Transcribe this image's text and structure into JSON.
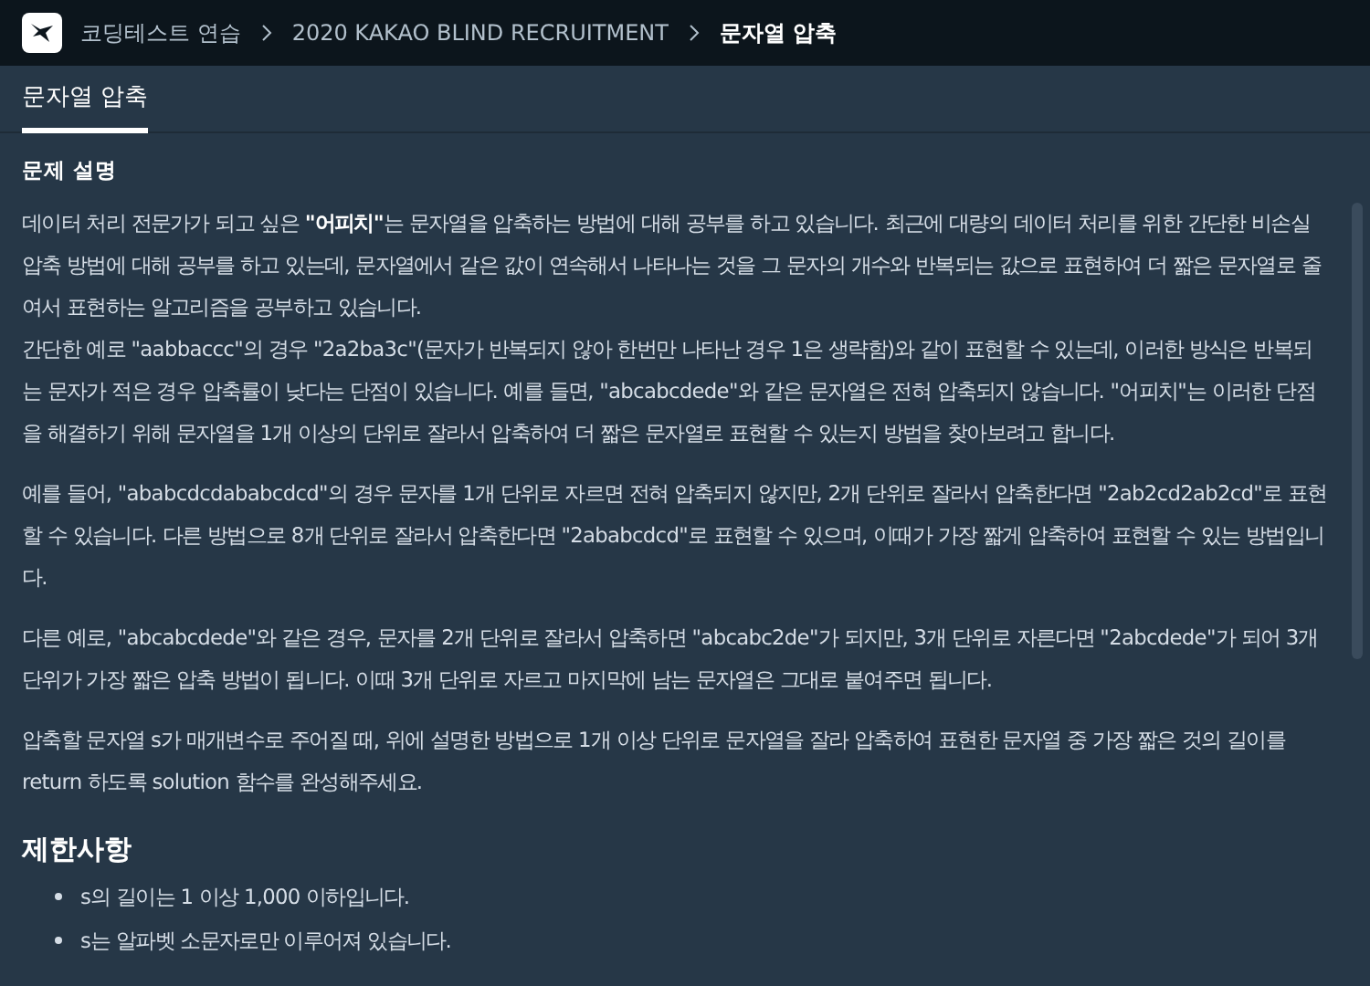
{
  "breadcrumb": [
    {
      "label": "코딩테스트 연습",
      "current": false
    },
    {
      "label": "2020 KAKAO BLIND RECRUITMENT",
      "current": false
    },
    {
      "label": "문자열 압축",
      "current": true
    }
  ],
  "tabs": [
    {
      "label": "문자열 압축",
      "selected": true
    }
  ],
  "section_title": "문제 설명",
  "paragraphs": [
    {
      "kind": "start",
      "text": "데이터 처리 전문가가 되고 싶은 **\"어피치\"**는 문자열을 압축하는 방법에 대해 공부를 하고 있습니다. 최근에 대량의 데이터 처리를 위한 간단한 비손실 압축 방법에 대해 공부를 하고 있는데, 문자열에서 같은 값이 연속해서 나타나는 것을 그 문자의 개수와 반복되는 값으로 표현하여 더 짧은 문자열로 줄여서 표현하는 알고리즘을 공부하고 있습니다."
    },
    {
      "kind": "continuation",
      "text": "간단한 예로 \"aabbaccc\"의 경우 \"2a2ba3c\"(문자가 반복되지 않아 한번만 나타난 경우 1은 생략함)와 같이 표현할 수 있는데, 이러한 방식은 반복되는 문자가 적은 경우 압축률이 낮다는 단점이 있습니다. 예를 들면, \"abcabcdede\"와 같은 문자열은 전혀 압축되지 않습니다. \"어피치\"는 이러한 단점을 해결하기 위해 문자열을 1개 이상의 단위로 잘라서 압축하여 더 짧은 문자열로 표현할 수 있는지 방법을 찾아보려고 합니다."
    },
    {
      "kind": "start",
      "text": "예를 들어, \"ababcdcdababcdcd\"의 경우 문자를 1개 단위로 자르면 전혀 압축되지 않지만, 2개 단위로 잘라서 압축한다면 \"2ab2cd2ab2cd\"로 표현할 수 있습니다. 다른 방법으로 8개 단위로 잘라서 압축한다면 \"2ababcdcd\"로 표현할 수 있으며, 이때가 가장 짧게 압축하여 표현할 수 있는 방법입니다."
    },
    {
      "kind": "start",
      "text": "다른 예로, \"abcabcdede\"와 같은 경우, 문자를 2개 단위로 잘라서 압축하면 \"abcabc2de\"가 되지만, 3개 단위로 자른다면 \"2abcdede\"가 되어 3개 단위가 가장 짧은 압축 방법이 됩니다. 이때 3개 단위로 자르고 마지막에 남는 문자열은 그대로 붙여주면 됩니다."
    },
    {
      "kind": "start",
      "text": "압축할 문자열 s가 매개변수로 주어질 때, 위에 설명한 방법으로 1개 이상 단위로 문자열을 잘라 압축하여 표현한 문자열 중 가장 짧은 것의 길이를 return 하도록 solution 함수를 완성해주세요."
    }
  ],
  "constraints": {
    "title": "제한사항",
    "items": [
      "s의 길이는 1 이상 1,000 이하입니다.",
      "s는 알파벳 소문자로만 이루어져 있습니다."
    ]
  }
}
